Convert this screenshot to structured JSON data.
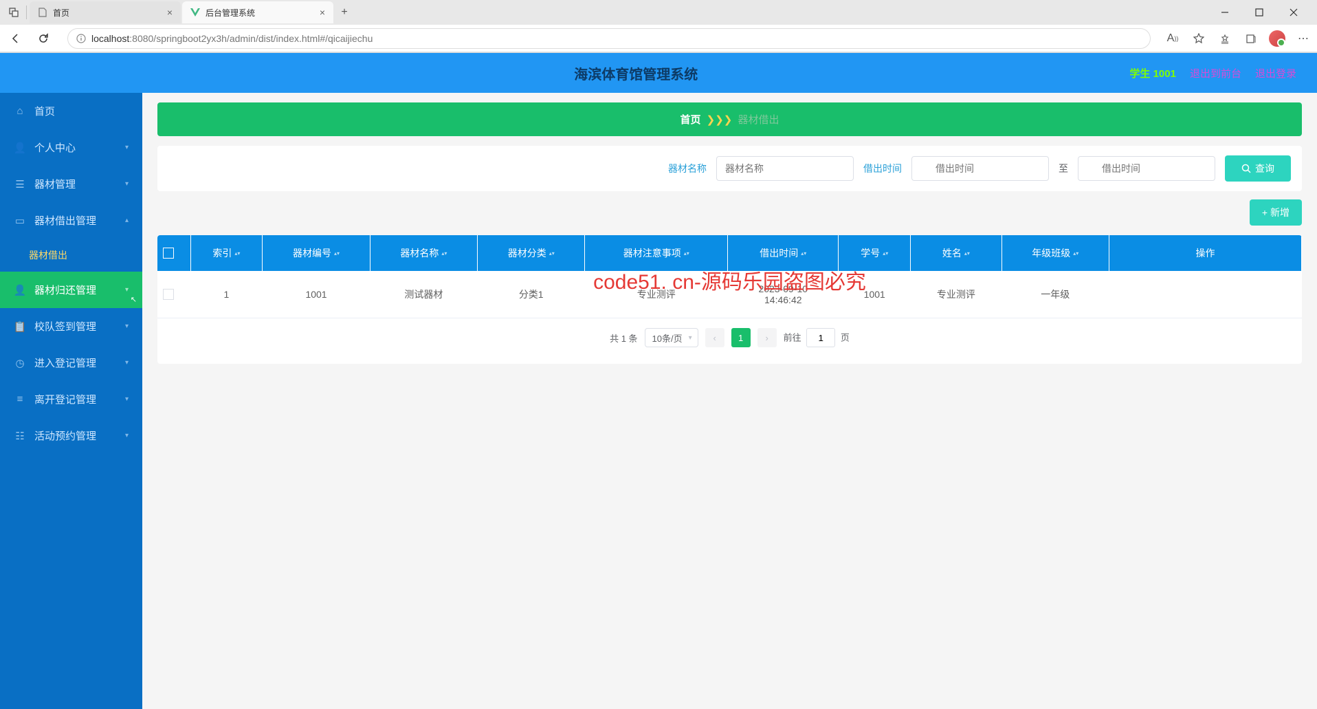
{
  "browser": {
    "tabs": [
      {
        "title": "首页",
        "active": false
      },
      {
        "title": "后台管理系统",
        "active": true
      }
    ],
    "url_prefix": "localhost",
    "url_rest": ":8080/springboot2yx3h/admin/dist/index.html#/qicaijiechu"
  },
  "header": {
    "title": "海滨体育馆管理系统",
    "user_role": "学生",
    "user_id": "1001",
    "exit_front": "退出到前台",
    "exit_login": "退出登录"
  },
  "sidebar": {
    "items": [
      {
        "label": "首页",
        "icon": "home",
        "expandable": false
      },
      {
        "label": "个人中心",
        "icon": "user",
        "expandable": true
      },
      {
        "label": "器材管理",
        "icon": "bars",
        "expandable": true
      },
      {
        "label": "器材借出管理",
        "icon": "monitor",
        "expandable": true,
        "expanded": true,
        "children": [
          {
            "label": "器材借出"
          }
        ]
      },
      {
        "label": "器材归还管理",
        "icon": "user",
        "expandable": true,
        "active": true
      },
      {
        "label": "校队签到管理",
        "icon": "clipboard",
        "expandable": true
      },
      {
        "label": "进入登记管理",
        "icon": "clock",
        "expandable": true
      },
      {
        "label": "离开登记管理",
        "icon": "list",
        "expandable": true
      },
      {
        "label": "活动预约管理",
        "icon": "calendar",
        "expandable": true
      }
    ]
  },
  "breadcrumb": {
    "home": "首页",
    "current": "器材借出"
  },
  "search": {
    "name_label": "器材名称",
    "name_placeholder": "器材名称",
    "time_label": "借出时间",
    "date_from_placeholder": "借出时间",
    "to_label": "至",
    "date_to_placeholder": "借出时间",
    "query_btn": "查询"
  },
  "toolbar": {
    "add_btn": "+ 新增"
  },
  "table": {
    "columns": [
      "索引",
      "器材编号",
      "器材名称",
      "器材分类",
      "器材注意事项",
      "借出时间",
      "学号",
      "姓名",
      "年级班级",
      "操作"
    ],
    "rows": [
      {
        "index": "1",
        "code": "1001",
        "name": "测试器材",
        "category": "分类1",
        "note": "专业测评",
        "time": "2023-09-10 14:46:42",
        "sid": "1001",
        "sname": "专业测评",
        "grade": "一年级"
      }
    ]
  },
  "pagination": {
    "total_text": "共 1 条",
    "page_size": "10条/页",
    "current": "1",
    "jump_prefix": "前往",
    "jump_value": "1",
    "jump_suffix": "页"
  },
  "watermark": "code51.cn",
  "watermark_red": "code51. cn-源码乐园盗图必究"
}
